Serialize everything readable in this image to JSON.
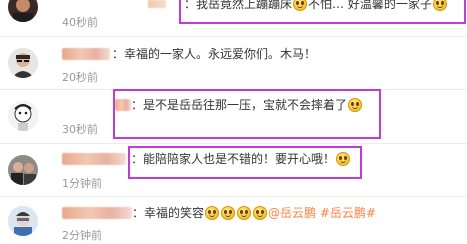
{
  "comments": [
    {
      "text_prefix": "：我岳竟然上蹦蹦床",
      "text_suffix": "不怕… 好温馨的一家子",
      "time": "40秒前",
      "emoji_after_prefix": "laugh-emoji",
      "emoji_end": "smile-emoji"
    },
    {
      "text": "：幸福的一家人。永远爱你们。木马！",
      "time": "20秒前"
    },
    {
      "text": "：是不是岳岳往那一压，宝就不会摔着了",
      "time": "30秒前",
      "emoji_end": "laugh-emoji"
    },
    {
      "text": "：能陪陪家人也是不错的！要开心哦！",
      "time": "1分钟前",
      "emoji_end": "smile-emoji"
    },
    {
      "text": "：幸福的笑容",
      "mention": "@岳云鹏",
      "hashtag": "#岳云鹏#",
      "time": "2分钟前",
      "emoji_count": 4
    }
  ],
  "colors": {
    "highlight": "#c13bd6",
    "link": "#ff8140",
    "time": "#999999",
    "text": "#333333"
  }
}
